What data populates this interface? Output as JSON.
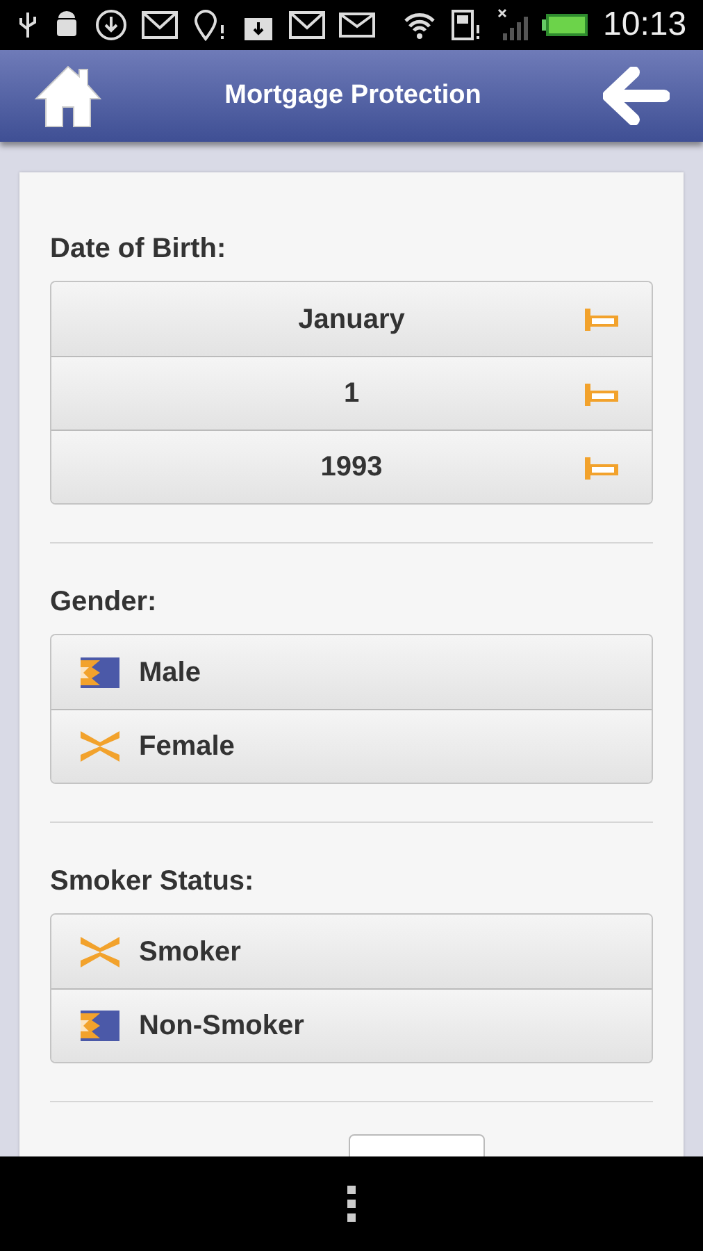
{
  "status_bar": {
    "time": "10:13"
  },
  "header": {
    "title": "Mortgage Protection"
  },
  "date_of_birth": {
    "label": "Date of Birth:",
    "selects": [
      {
        "value": "January"
      },
      {
        "value": "1"
      },
      {
        "value": "1993"
      }
    ]
  },
  "gender": {
    "label": "Gender:",
    "options": [
      {
        "label": "Male",
        "selected": true
      },
      {
        "label": "Female",
        "selected": false
      }
    ]
  },
  "smoker_status": {
    "label": "Smoker Status:",
    "options": [
      {
        "label": "Smoker",
        "selected": false
      },
      {
        "label": "Non-Smoker",
        "selected": true
      }
    ]
  }
}
